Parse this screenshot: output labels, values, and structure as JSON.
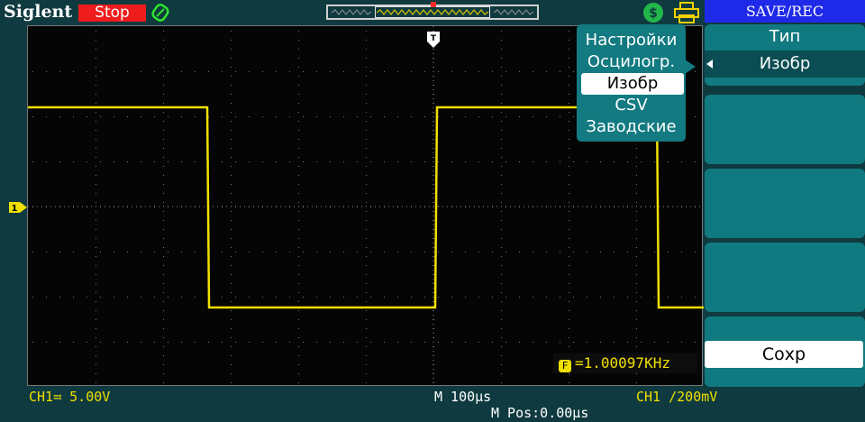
{
  "brand": "Siglent",
  "status": "Stop",
  "save_menu": {
    "title": "SAVE/REC",
    "type_label": "Тип",
    "type_value": "Изобр",
    "save_button": "Сохр"
  },
  "type_popup": {
    "options": [
      "Настройки",
      "Осцилогр.",
      "Изобр",
      "CSV",
      "Заводские"
    ],
    "selected": "Изобр"
  },
  "measure": {
    "frequency": "=1.00097KHz"
  },
  "bottom": {
    "ch1_scale": "CH1≕ 5.00V",
    "timebase": "M 100µs",
    "m_pos": "M Pos:0.00µs",
    "trigger": "CH1 ∕200mV"
  },
  "colors": {
    "trace": "#f0e000",
    "status_stop": "#ee1c1c",
    "menu_title": "#1f2ae8",
    "menu_panel": "#117a80"
  },
  "icons": [
    "run-state-icon",
    "usb-icon",
    "printer-icon",
    "channel-marker-icon",
    "trigger-position-icon"
  ]
}
